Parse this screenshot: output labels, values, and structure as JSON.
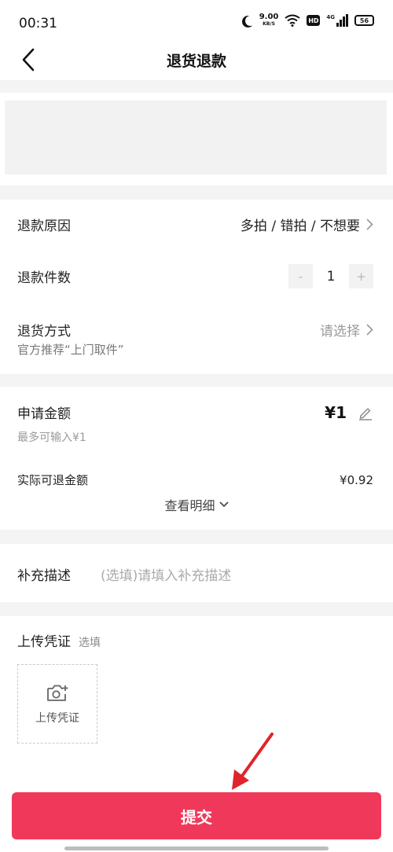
{
  "status_bar": {
    "time": "00:31",
    "net_speed_value": "9.00",
    "net_speed_unit": "KB/S",
    "hd_label": "HD",
    "network_label": "4G",
    "battery": "56"
  },
  "nav": {
    "title": "退货退款",
    "back_icon": "chevron-left-icon"
  },
  "refund_info": {
    "reason_label": "退款原因",
    "reason_value": "多拍 / 错拍 / 不想要",
    "quantity_label": "退款件数",
    "quantity_value": "1",
    "minus_symbol": "-",
    "plus_symbol": "+",
    "method_label": "退货方式",
    "method_value": "请选择",
    "method_hint": "官方推荐“上门取件”"
  },
  "amount": {
    "label": "申请金额",
    "value": "¥1",
    "max_hint": "最多可输入¥1",
    "actual_label": "实际可退金额",
    "actual_value": "¥0.92",
    "detail_link": "查看明细"
  },
  "description": {
    "label": "补充描述",
    "placeholder": "(选填)请填入补充描述"
  },
  "upload": {
    "title": "上传凭证",
    "optional": "选填",
    "button_label": "上传凭证",
    "icon": "camera-plus-icon"
  },
  "submit_label": "提交",
  "colors": {
    "accent": "#f0395a",
    "background": "#f4f4f4",
    "arrow": "#e0242b"
  }
}
